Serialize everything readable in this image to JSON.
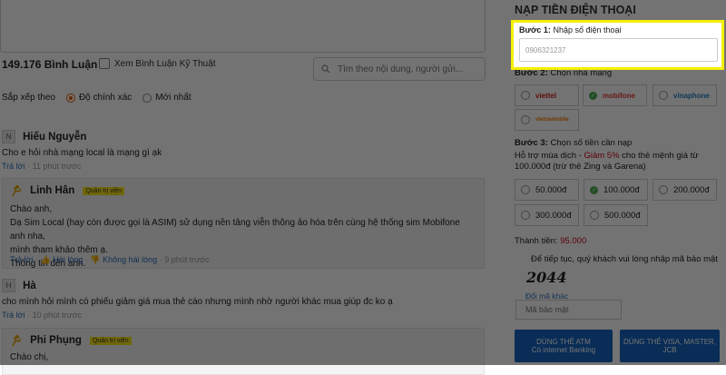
{
  "comments_area": {
    "count_label": "149.176 Bình Luận",
    "tech_checkbox_label": "Xem Bình Luận Kỹ Thuật",
    "search_placeholder": "Tìm theo nội dung, người gửi...",
    "sort_label": "Sắp xếp theo",
    "sort_options": [
      "Độ chính xác",
      "Mới nhất"
    ],
    "comments": [
      {
        "initial": "N",
        "name": "Hiếu Nguyễn",
        "text": "Cho e hỏi nhà mạng local là mạng gì ạk",
        "reply": "Trả lời",
        "time": "11 phút trước",
        "staff_reply": {
          "name": "Linh Hân",
          "badge": "Quản trị viên",
          "lines": [
            "Chào anh,",
            "Dạ Sim Local (hay còn được gọi là ASIM) sử dụng nền tảng viễn thông ảo hóa trên cùng hệ thống sim Mobifone anh nha,",
            "mình tham khảo thêm ạ.",
            "Thông tin đến anh."
          ],
          "reply": "Trả lời",
          "like": "Hài lòng",
          "dislike": "Không hài lòng",
          "time": "9 phút trước"
        }
      },
      {
        "initial": "H",
        "name": "Hà",
        "text": "cho mình hỏi mình có phiếu giảm giá mua thẻ cào nhưng mình nhờ người khác mua giúp đc ko ạ",
        "reply": "Trả lời",
        "time": "10 phút trước",
        "staff_reply": {
          "name": "Phi Phụng",
          "badge": "Quản trị viên",
          "lines": [
            "Chào chị,"
          ]
        }
      }
    ]
  },
  "topup_panel": {
    "title": "NẠP TIỀN ĐIỆN THOẠI",
    "step1_label": "Bước 1:",
    "step1_text": "Nhập số điện thoại",
    "phone_value": "0906321237",
    "step2_label": "Bước 2:",
    "step2_text": "Chọn nhà mạng",
    "carriers": [
      "viettel",
      "mobifone",
      "vinaphone",
      "vietnamobile"
    ],
    "selected_carrier": "mobifone",
    "step3_label": "Bước 3:",
    "step3_text": "Chọn số tiền cần nạp",
    "promo_prefix": "Hỗ trợ mùa dịch -",
    "promo_highlight": "Giảm 5%",
    "promo_suffix": "cho thẻ mệnh giá từ 100.000đ (trừ thẻ Zing và Garena)",
    "amounts": [
      "50.000đ",
      "100.000đ",
      "200.000đ",
      "300.000đ",
      "500.000đ"
    ],
    "selected_amount": "100.000đ",
    "total_label": "Thành tiền:",
    "total_value": "95.000",
    "captcha_note": "Để tiếp tục, quý khách vui lòng nhập mã bảo mật",
    "captcha_code": "2044",
    "change_code": "Đổi mã khác",
    "captcha_placeholder": "Mã bảo mật",
    "btn_atm_line1": "DÙNG THẺ ATM",
    "btn_atm_line2": "Có internet Banking",
    "btn_visa_line1": "DÙNG THẺ VISA, MASTER,",
    "btn_visa_line2": "JCB"
  },
  "colors": {
    "highlight_border": "#f5f000",
    "accent_red": "#d0021b",
    "button_blue": "#1565c0",
    "link_blue": "#2a6cb5",
    "badge_yellow": "#f8e21a",
    "viettel": "#d81e1e",
    "mobifone": "#e53935",
    "vinaphone": "#1f7fc2",
    "vietnamobile": "#f57c00"
  }
}
